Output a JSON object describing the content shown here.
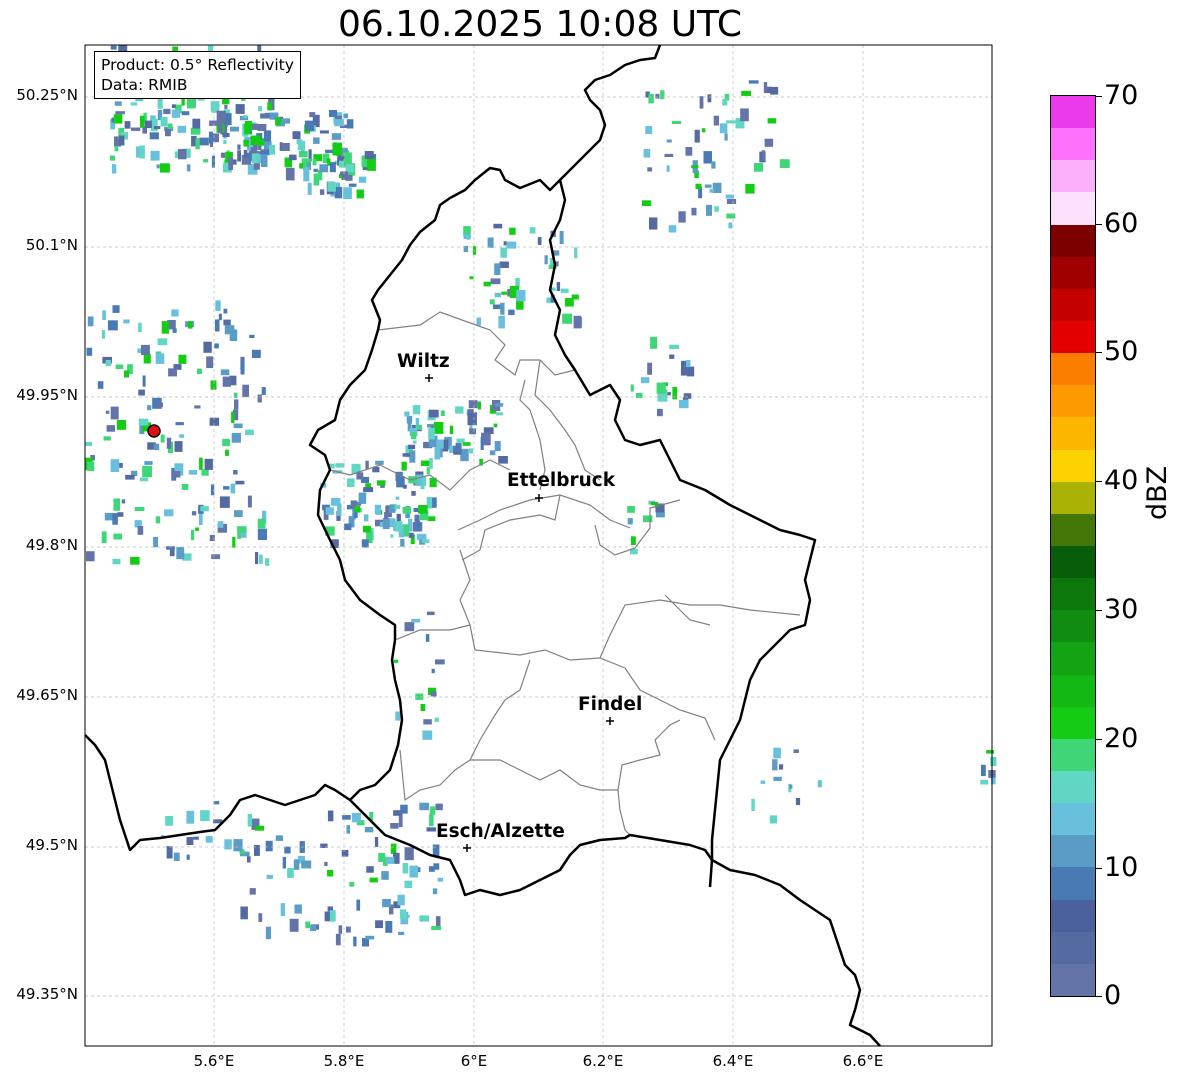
{
  "title": "06.10.2025 10:08 UTC",
  "info": {
    "product": "Product: 0.5° Reflectivity",
    "data": "Data: RMIB"
  },
  "axes": {
    "lat_ticks": [
      "50.25°N",
      "50.1°N",
      "49.95°N",
      "49.8°N",
      "49.65°N",
      "49.5°N",
      "49.35°N"
    ],
    "lon_ticks": [
      "5.6°E",
      "5.8°E",
      "6°E",
      "6.2°E",
      "6.4°E",
      "6.6°E"
    ],
    "grid": true
  },
  "cities": [
    {
      "name": "Wiltz"
    },
    {
      "name": "Ettelbruck"
    },
    {
      "name": "Findel"
    },
    {
      "name": "Esch/Alzette"
    }
  ],
  "radar_site": "red-circle-marker",
  "colorbar": {
    "label": "dBZ",
    "ticks": [
      "0",
      "10",
      "20",
      "30",
      "40",
      "50",
      "60",
      "70"
    ],
    "colors": [
      "#6474a8",
      "#566aa2",
      "#4a619e",
      "#4a7ab4",
      "#5b9cc6",
      "#68c0dc",
      "#62d6c4",
      "#3ed676",
      "#14cc14",
      "#14b814",
      "#12a412",
      "#108c10",
      "#0c780c",
      "#085e08",
      "#427606",
      "#aab204",
      "#fcd200",
      "#fcb600",
      "#fc9a00",
      "#fc7e00",
      "#e40000",
      "#c40000",
      "#a00000",
      "#7c0000",
      "#fce0fc",
      "#fcb0fc",
      "#fc72fc",
      "#ea3aea"
    ]
  }
}
